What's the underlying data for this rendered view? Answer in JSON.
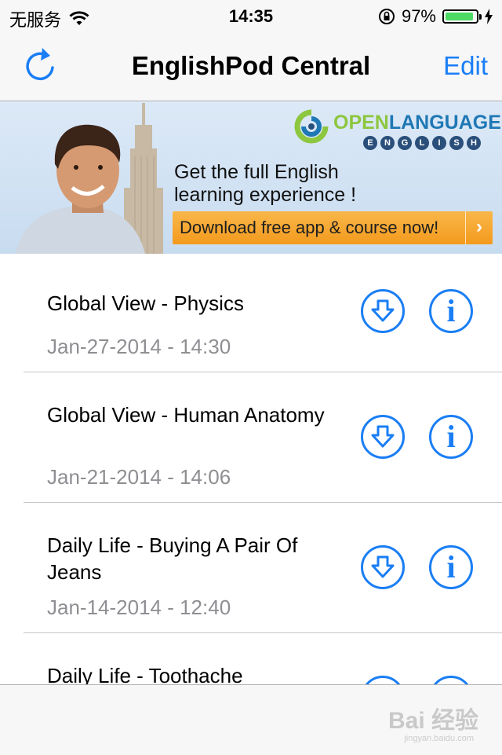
{
  "status_bar": {
    "carrier": "无服务",
    "time": "14:35",
    "battery_percent": "97%",
    "battery_level": 0.97
  },
  "nav": {
    "title": "EnglishPod Central",
    "edit_label": "Edit"
  },
  "banner": {
    "brand_open": "OPEN",
    "brand_language": "LANGUAGE",
    "brand_sub": [
      "E",
      "N",
      "G",
      "L",
      "I",
      "S",
      "H"
    ],
    "headline_line1": "Get the full English",
    "headline_line2": "learning experience !",
    "cta_label": "Download free app & course now!",
    "cta_arrow": "›"
  },
  "items": [
    {
      "title": "Global View - Physics",
      "date": "Jan-27-2014 - 14:30"
    },
    {
      "title": "Global View - Human Anatomy",
      "date": "Jan-21-2014 - 14:06"
    },
    {
      "title": "Daily Life - Buying A Pair Of Jeans",
      "date": "Jan-14-2014 - 12:40"
    },
    {
      "title": "Daily Life - Toothache",
      "date": ""
    }
  ],
  "watermark": {
    "text": "Bai 经验",
    "sub": "jingyan.baidu.com"
  },
  "colors": {
    "accent": "#1a7ef5",
    "date_gray": "#8e8e93",
    "battery_green": "#4cd964",
    "cta_orange": "#f39a1d"
  }
}
